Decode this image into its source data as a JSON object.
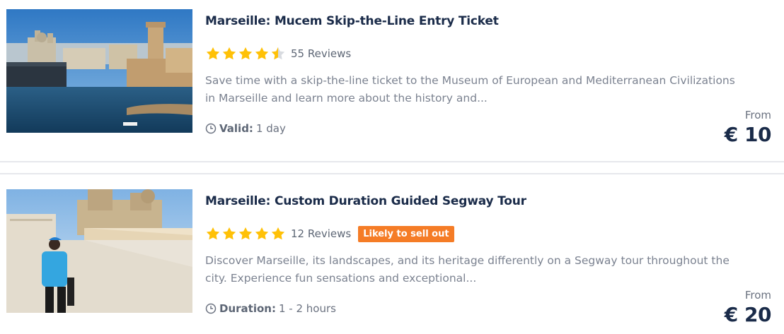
{
  "colors": {
    "star": "#ffc107",
    "badge_bg": "#f57c26",
    "title": "#1a2b49",
    "text_muted": "#7b8290"
  },
  "listings": [
    {
      "title": "Marseille: Mucem Skip-the-Line Entry Ticket",
      "rating": 4.5,
      "reviews": "55 Reviews",
      "badge": "",
      "description_line1": "Save time with a skip-the-line ticket to the Museum of European and Mediterranean Civilizations",
      "description_line2": "in Marseille and learn more about the history and...",
      "meta_icon": "clock-icon",
      "meta_label": "Valid:",
      "meta_value": "1 day",
      "price_prefix": "From",
      "price": "€ 10"
    },
    {
      "title": "Marseille: Custom Duration Guided Segway Tour",
      "rating": 5,
      "reviews": "12 Reviews",
      "badge": "Likely to sell out",
      "description_line1": "Discover Marseille, its landscapes, and its heritage differently on a Segway tour throughout the",
      "description_line2": "city. Experience fun sensations and exceptional...",
      "meta_icon": "clock-icon",
      "meta_label": "Duration:",
      "meta_value": "1 - 2 hours",
      "price_prefix": "From",
      "price": "€ 20"
    }
  ]
}
